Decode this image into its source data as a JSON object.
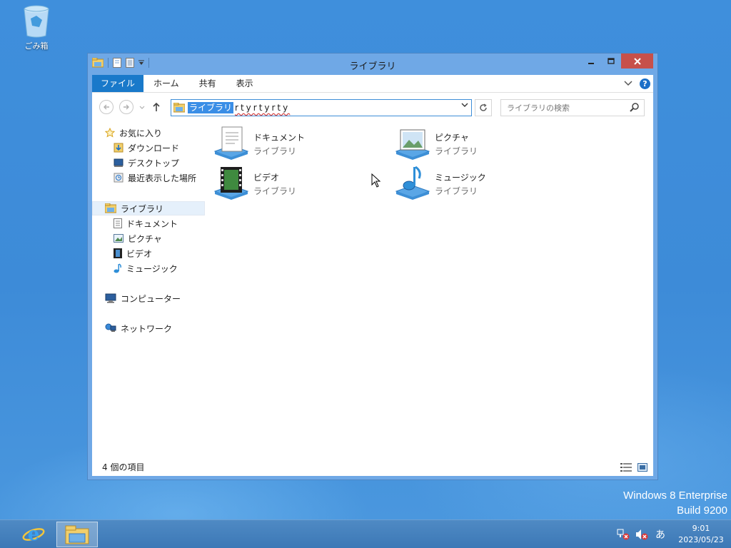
{
  "desktop": {
    "recycle_bin_label": "ごみ箱",
    "watermark_line1": "Windows 8 Enterprise",
    "watermark_line2": "Build 9200"
  },
  "window": {
    "title": "ライブラリ",
    "ribbon": {
      "tabs": [
        "ファイル",
        "ホーム",
        "共有",
        "表示"
      ]
    },
    "address": {
      "selected_text": "ライブラリ",
      "typed_text": "rtyrtyrty"
    },
    "search": {
      "placeholder": "ライブラリの検索"
    },
    "nav_pane": {
      "favorites": {
        "label": "お気に入り",
        "items": [
          "ダウンロード",
          "デスクトップ",
          "最近表示した場所"
        ]
      },
      "libraries": {
        "label": "ライブラリ",
        "items": [
          "ドキュメント",
          "ピクチャ",
          "ビデオ",
          "ミュージック"
        ]
      },
      "computer": "コンピューター",
      "network": "ネットワーク"
    },
    "libraries": [
      {
        "name": "ドキュメント",
        "type": "ライブラリ",
        "icon": "document-library-icon"
      },
      {
        "name": "ピクチャ",
        "type": "ライブラリ",
        "icon": "picture-library-icon"
      },
      {
        "name": "ビデオ",
        "type": "ライブラリ",
        "icon": "video-library-icon"
      },
      {
        "name": "ミュージック",
        "type": "ライブラリ",
        "icon": "music-library-icon"
      }
    ],
    "status_text": "4 個の項目"
  },
  "taskbar": {
    "clock_time": "9:01",
    "clock_date": "2023/05/23",
    "ime": "あ"
  },
  "colors": {
    "accent": "#1979ca",
    "window_frame": "#6fa8e6",
    "desktop": "#3d8bd8",
    "close_button": "#c7504a"
  }
}
